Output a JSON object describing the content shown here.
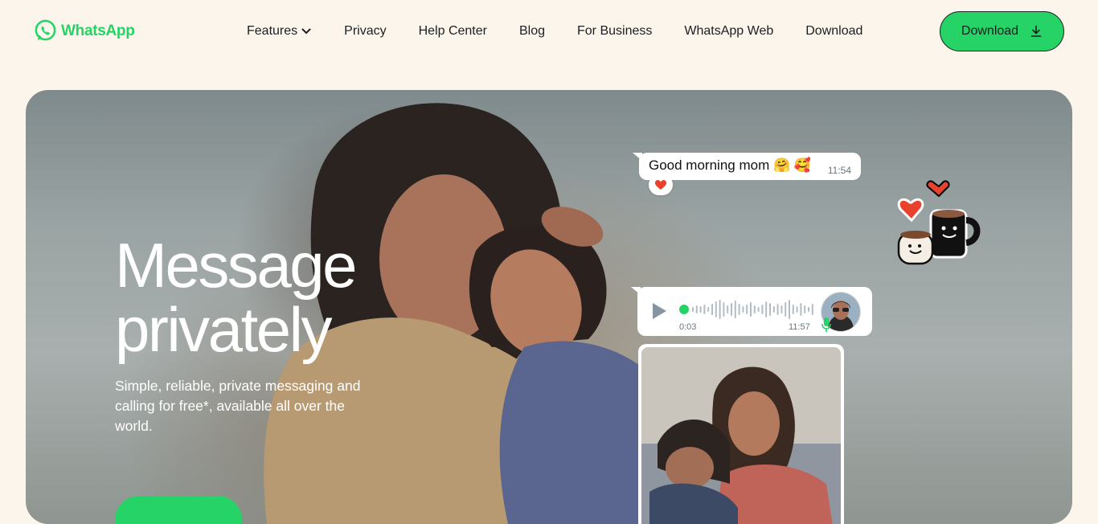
{
  "brand": {
    "name": "WhatsApp",
    "color": "#25D366",
    "icon": "whatsapp-logo-icon"
  },
  "nav": {
    "items": [
      {
        "label": "Features",
        "has_dropdown": true
      },
      {
        "label": "Privacy"
      },
      {
        "label": "Help Center"
      },
      {
        "label": "Blog"
      },
      {
        "label": "For Business"
      },
      {
        "label": "WhatsApp Web"
      },
      {
        "label": "Download"
      }
    ],
    "download_button": {
      "label": "Download",
      "icon": "download-arrow-icon"
    }
  },
  "hero": {
    "title_line1": "Message",
    "title_line2": "privately",
    "subtitle": "Simple, reliable, private messaging and calling for free*, available all over the world."
  },
  "chat": {
    "message1": {
      "text": "Good morning mom 🤗 🥰",
      "time": "11:54",
      "reaction": "❤️"
    },
    "voice_note": {
      "elapsed": "0:03",
      "time": "11:57"
    }
  },
  "colors": {
    "page_background": "#FCF5EB",
    "accent": "#25D366",
    "text": "#1C1E21"
  }
}
